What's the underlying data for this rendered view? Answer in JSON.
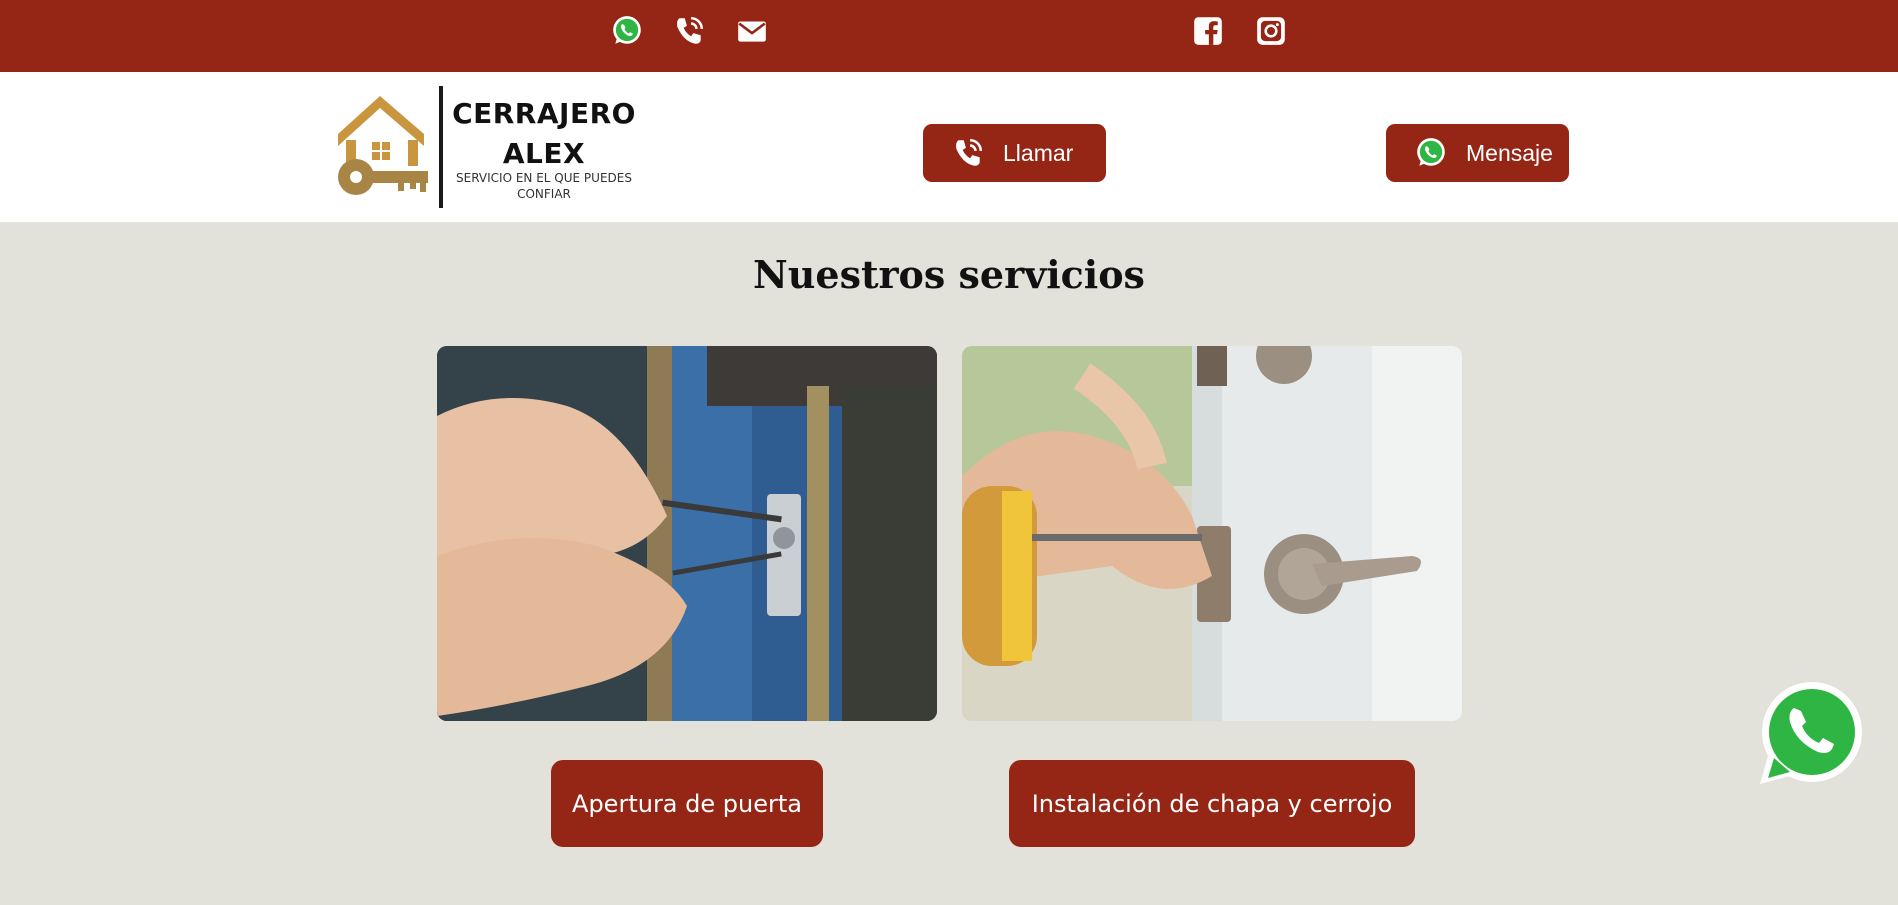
{
  "topbar": {
    "icons": [
      "whatsapp-icon",
      "phone-icon",
      "mail-icon",
      "facebook-icon",
      "instagram-icon"
    ]
  },
  "logo": {
    "title_line1": "CERRAJERO",
    "title_line2": "ALEX",
    "subtitle_line1": "SERVICIO EN EL QUE PUEDES",
    "subtitle_line2": "CONFIAR"
  },
  "header": {
    "call_label": "Llamar",
    "message_label": "Mensaje"
  },
  "services": {
    "title": "Nuestros servicios",
    "items": [
      {
        "label": "Apertura de puerta",
        "image": "lockpicking-photo"
      },
      {
        "label": "Instalación de chapa y cerrojo",
        "image": "lock-installation-photo"
      }
    ]
  },
  "floating": {
    "icon": "whatsapp-icon"
  },
  "colors": {
    "brand": "#952616",
    "background": "#e2e1da",
    "header_bg": "#ffffff",
    "logo_gold": "#c9963f",
    "whatsapp": "#2fb544"
  }
}
